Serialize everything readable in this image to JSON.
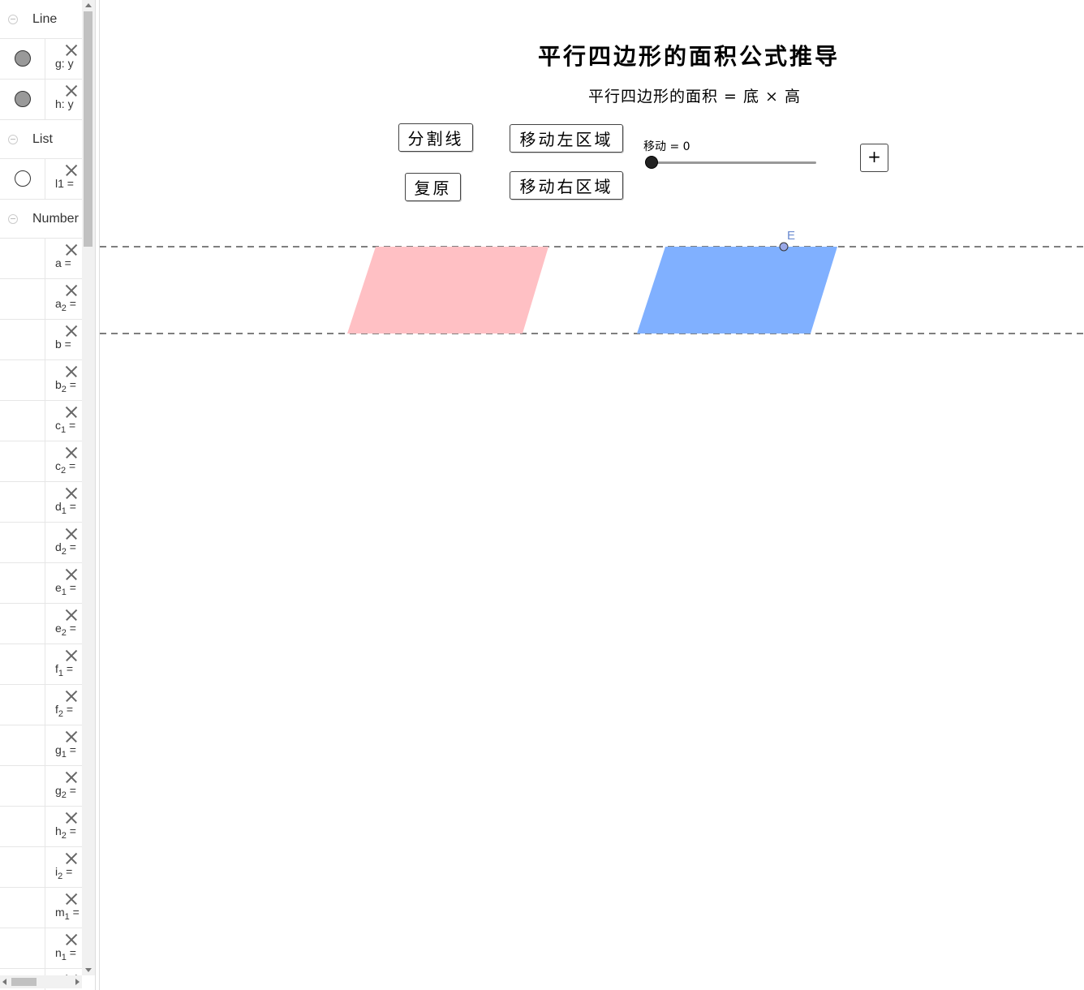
{
  "algebra_panel": {
    "groups": [
      {
        "label": "Line",
        "items": [
          {
            "text": "g: y",
            "visibility": "filled"
          },
          {
            "text": "h: y",
            "visibility": "filled"
          }
        ]
      },
      {
        "label": "List",
        "items": [
          {
            "text": "l1 =",
            "visibility": "empty"
          }
        ]
      },
      {
        "label": "Number",
        "items": [
          {
            "name": "a",
            "sub": "",
            "eq": " ="
          },
          {
            "name": "a",
            "sub": "2",
            "eq": " ="
          },
          {
            "name": "b",
            "sub": "",
            "eq": " ="
          },
          {
            "name": "b",
            "sub": "2",
            "eq": " ="
          },
          {
            "name": "c",
            "sub": "1",
            "eq": " ="
          },
          {
            "name": "c",
            "sub": "2",
            "eq": " ="
          },
          {
            "name": "d",
            "sub": "1",
            "eq": " ="
          },
          {
            "name": "d",
            "sub": "2",
            "eq": " ="
          },
          {
            "name": "e",
            "sub": "1",
            "eq": " ="
          },
          {
            "name": "e",
            "sub": "2",
            "eq": " ="
          },
          {
            "name": "f",
            "sub": "1",
            "eq": " ="
          },
          {
            "name": "f",
            "sub": "2",
            "eq": " ="
          },
          {
            "name": "g",
            "sub": "1",
            "eq": " ="
          },
          {
            "name": "g",
            "sub": "2",
            "eq": " ="
          },
          {
            "name": "h",
            "sub": "2",
            "eq": " ="
          },
          {
            "name": "i",
            "sub": "2",
            "eq": " ="
          },
          {
            "name": "m",
            "sub": "1",
            "eq": " ="
          },
          {
            "name": "n",
            "sub": "1",
            "eq": " ="
          },
          {
            "name": "",
            "sub": "",
            "eq": ""
          }
        ]
      }
    ]
  },
  "graphics": {
    "title": "平行四边形的面积公式推导",
    "formula": "平行四边形的面积 = 底 × 高",
    "buttons": {
      "split_line": "分割线",
      "move_left": "移动左区域",
      "restore": "复原",
      "move_right": "移动右区域"
    },
    "slider": {
      "name": "移动",
      "value": 0,
      "label": "移动 = 0"
    },
    "add_button": "+",
    "point_label": "E",
    "colors": {
      "left_parallelogram": "#ffc0c4",
      "right_parallelogram": "#80b0ff",
      "point_fill": "#9aa8e6",
      "point_label": "#6a8ad0",
      "dashed_line": "#333333"
    }
  }
}
